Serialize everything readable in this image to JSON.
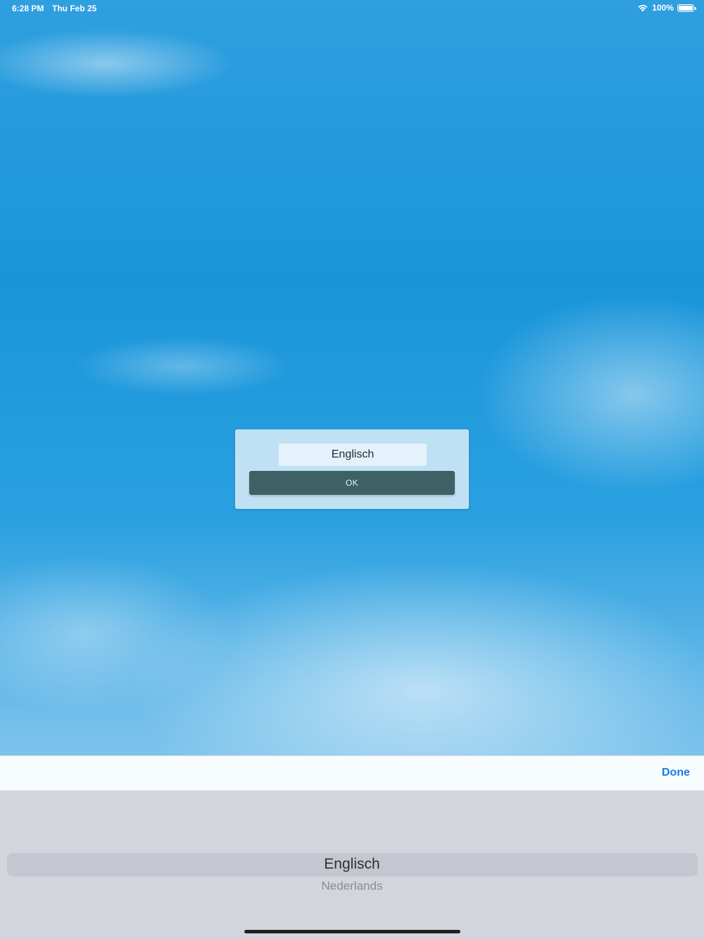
{
  "status_bar": {
    "time": "6:28 PM",
    "date": "Thu Feb 25",
    "battery": "100%",
    "battery_level": 1.0
  },
  "dialog": {
    "language_value": "Englisch",
    "ok_label": "OK"
  },
  "picker_toolbar": {
    "done_label": "Done"
  },
  "picker": {
    "options": [
      "Englisch",
      "Nederlands"
    ],
    "selected_index": 0
  },
  "colors": {
    "ok_button": "#3f6166",
    "done_text": "#1a7ae6",
    "picker_background": "#d2d5dc"
  }
}
